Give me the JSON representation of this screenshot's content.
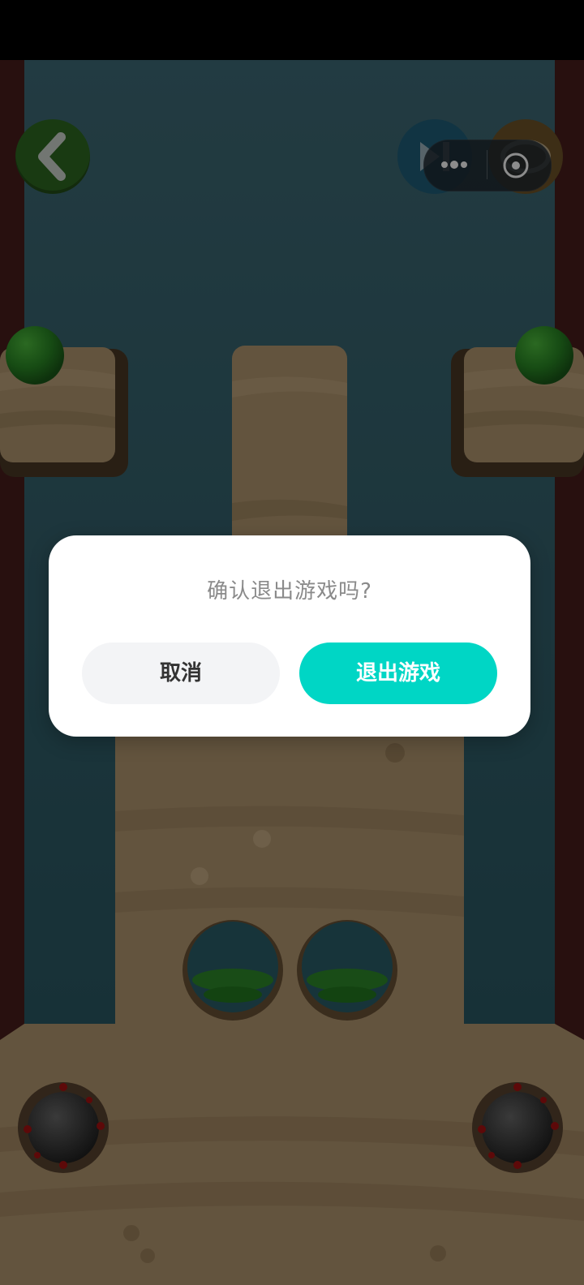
{
  "dialog": {
    "title": "确认退出游戏吗?",
    "cancel_label": "取消",
    "confirm_label": "退出游戏"
  },
  "hud": {
    "back_icon": "chevron-left-icon",
    "skip_icon": "play-skip-icon",
    "hint_icon": "eye-icon",
    "capsule_icons": [
      "more-dots-icon",
      "record-target-icon"
    ]
  },
  "colors": {
    "accent": "#00d6c5",
    "water": "#2a5f6b",
    "sand": "#8a6f4e",
    "ball_green": "#2f8a2a"
  }
}
